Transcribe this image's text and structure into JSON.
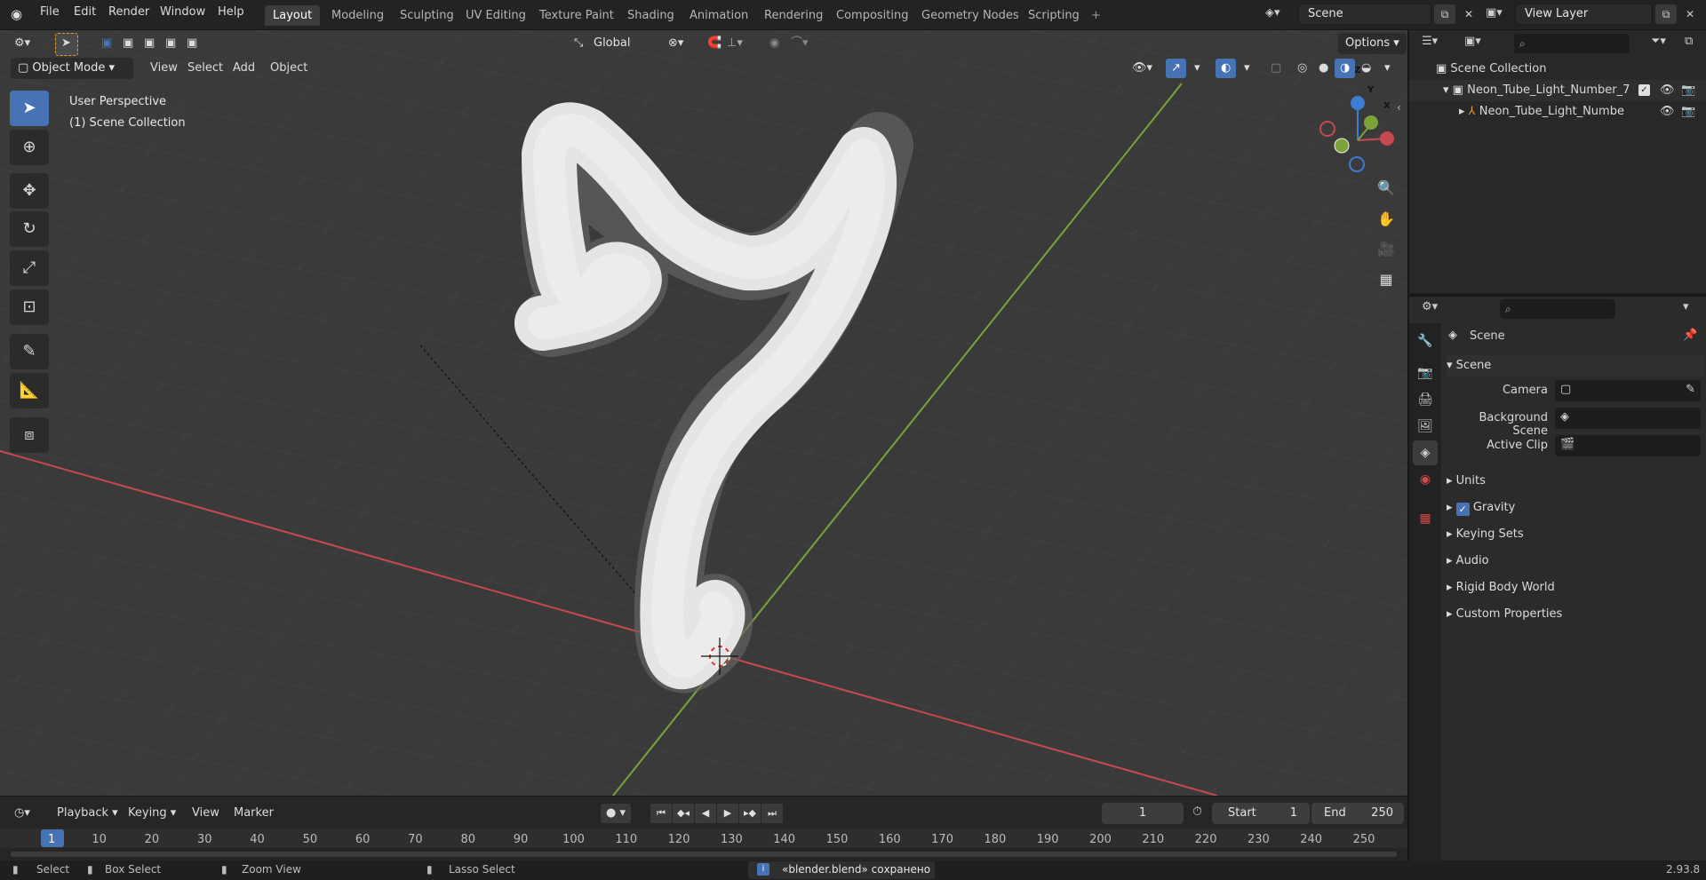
{
  "menu": [
    "File",
    "Edit",
    "Render",
    "Window",
    "Help"
  ],
  "workspaces": [
    "Layout",
    "Modeling",
    "Sculpting",
    "UV Editing",
    "Texture Paint",
    "Shading",
    "Animation",
    "Rendering",
    "Compositing",
    "Geometry Nodes",
    "Scripting"
  ],
  "active_workspace": "Layout",
  "scene_selector": "Scene",
  "view_layer_selector": "View Layer",
  "viewport": {
    "mode": "Object Mode",
    "menus": [
      "View",
      "Select",
      "Add",
      "Object"
    ],
    "transform_orientation": "Global",
    "options_label": "Options",
    "overlay_title": "User Perspective",
    "overlay_collection": "(1) Scene Collection",
    "gizmo_axes": {
      "x": "X",
      "y": "Y",
      "z": "Z"
    }
  },
  "timeline": {
    "menus": [
      "Playback",
      "Keying",
      "View",
      "Marker"
    ],
    "current_frame": "1",
    "start_label": "Start",
    "start_value": "1",
    "end_label": "End",
    "end_value": "250",
    "ruler": [
      "1",
      "10",
      "20",
      "30",
      "40",
      "50",
      "60",
      "70",
      "80",
      "90",
      "100",
      "110",
      "120",
      "130",
      "140",
      "150",
      "160",
      "170",
      "180",
      "190",
      "200",
      "210",
      "220",
      "230",
      "240",
      "250"
    ]
  },
  "status": {
    "select": "Select",
    "box_select": "Box Select",
    "zoom_view": "Zoom View",
    "lasso_select": "Lasso Select",
    "message": "«blender.blend» сохранено",
    "version": "2.93.8"
  },
  "outliner": {
    "root": "Scene Collection",
    "collection": "Neon_Tube_Light_Number_7",
    "object": "Neon_Tube_Light_Numbe"
  },
  "properties": {
    "context": "Scene",
    "section": "Scene",
    "camera_label": "Camera",
    "background_scene_label": "Background Scene",
    "active_clip_label": "Active Clip",
    "panels": [
      "Units",
      "Gravity",
      "Keying Sets",
      "Audio",
      "Rigid Body World",
      "Custom Properties"
    ],
    "gravity_checked": true
  },
  "colors": {
    "accent": "#4772b3",
    "x_axis": "#c8484f",
    "y_axis": "#7ba33a",
    "z_axis": "#3b7ed4",
    "viewport_bg": "#3a3a3a"
  }
}
